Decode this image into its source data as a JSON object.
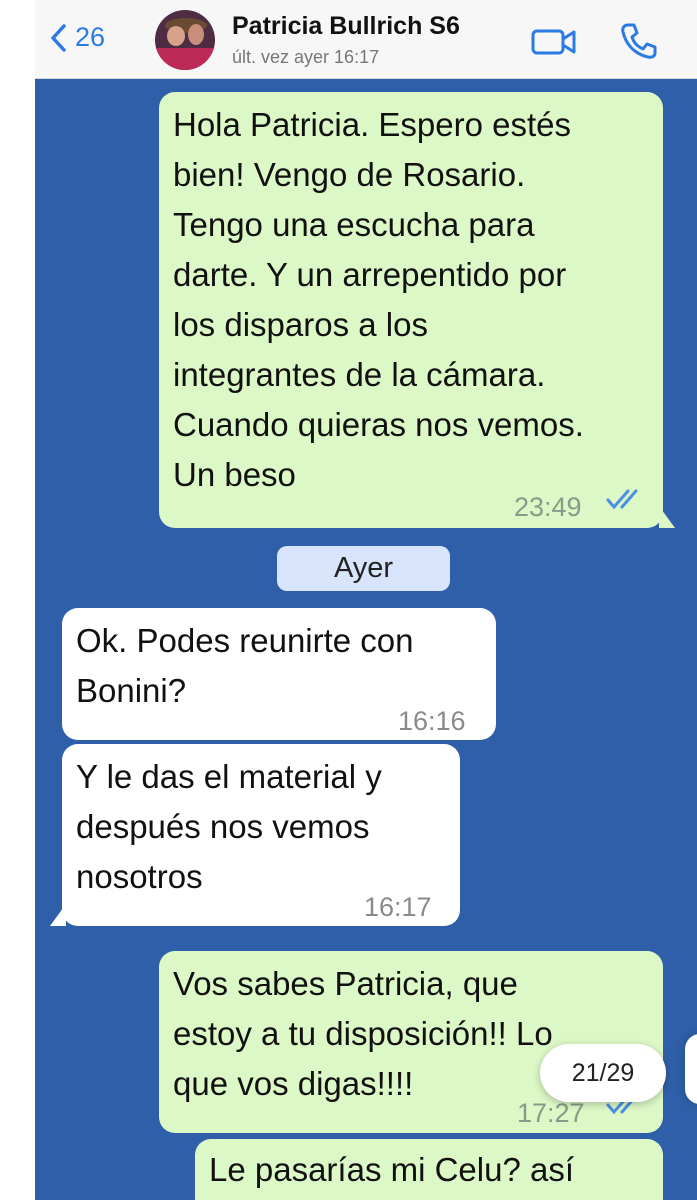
{
  "header": {
    "back_count": "26",
    "contact_name": "Patricia Bullrich S6",
    "last_seen": "últ. vez ayer 16:17",
    "icons": [
      "chevron-left-icon",
      "video-call-icon",
      "phone-icon"
    ],
    "accent_color": "#2b7be5"
  },
  "chat": {
    "background_color": "#2f5fa8",
    "messages": [
      {
        "direction": "outgoing",
        "text": "Hola Patricia. Espero estés\nbien! Vengo de Rosario.\nTengo una escucha para\ndarte. Y un arrepentido por\nlos disparos a los\nintegrantes de la cámara.\nCuando quieras nos vemos.\nUn beso",
        "time": "23:49",
        "status": "read"
      },
      {
        "direction": "incoming",
        "text": "Ok. Podes reunirte con\nBonini?",
        "time": "16:16"
      },
      {
        "direction": "incoming",
        "text": "Y le das el material y\ndespués nos vemos\nnosotros",
        "time": "16:17"
      },
      {
        "direction": "outgoing",
        "text": "Vos sabes Patricia, que\nestoy a tu disposición!! Lo\nque vos digas!!!!",
        "time": "17:27",
        "status": "read"
      },
      {
        "direction": "outgoing",
        "text": "Le pasarías mi Celu? así",
        "time": ""
      }
    ],
    "date_separator": "Ayer",
    "outgoing_color": "#dcf8c6",
    "incoming_color": "#ffffff"
  },
  "overlay": {
    "page_indicator": "21/29"
  }
}
